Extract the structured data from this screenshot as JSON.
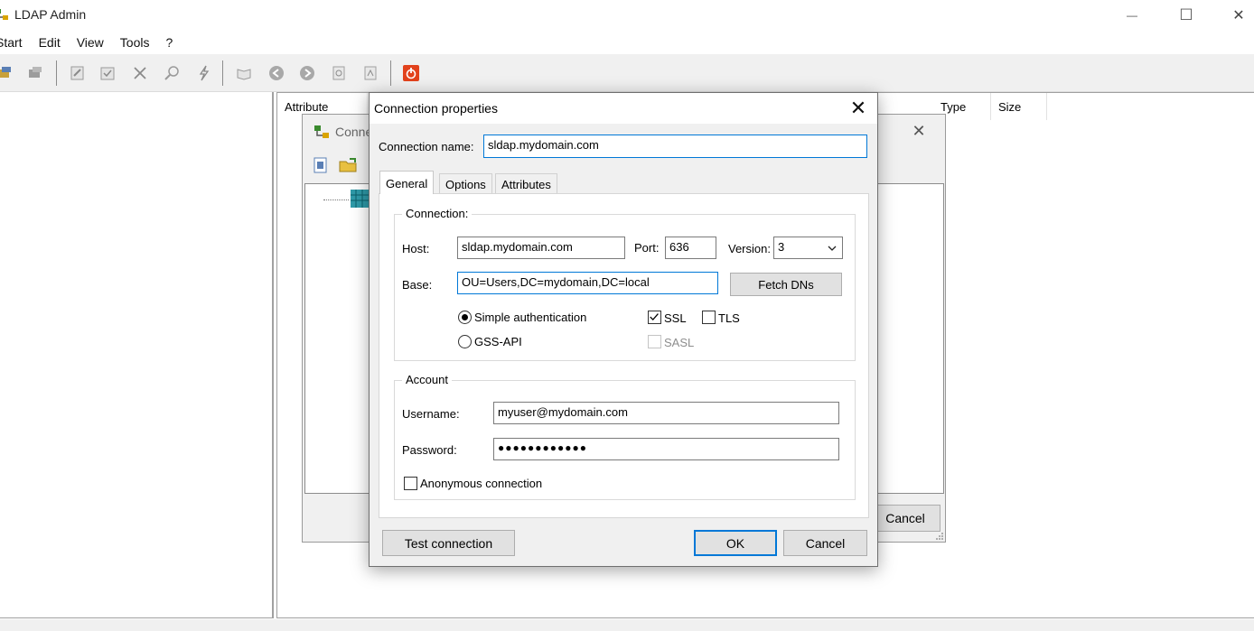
{
  "app": {
    "title": "LDAP Admin",
    "menu": [
      "Start",
      "Edit",
      "View",
      "Tools",
      "?"
    ],
    "window_controls": {
      "minimize": "—",
      "maximize": "☐",
      "close": "✕"
    }
  },
  "toolbar": {
    "icons": [
      "connect-icon",
      "disconnect-icon",
      "edit-icon",
      "save-icon",
      "delete-icon",
      "search-icon",
      "modify-icon",
      "bookmark-icon",
      "back-icon",
      "forward-icon",
      "refresh-icon",
      "schema-icon",
      "exit-icon"
    ],
    "accent": "#e2421c"
  },
  "entries_view": {
    "columns": [
      "Attribute",
      "Type",
      "Size"
    ]
  },
  "connections_dialog": {
    "title": "Conne",
    "close": "✕",
    "cancel_label": "Cancel"
  },
  "dialog": {
    "title": "Connection properties",
    "close": "✕",
    "connection_name_label": "Connection name:",
    "connection_name_value": "sldap.mydomain.com",
    "tabs": [
      "General",
      "Options",
      "Attributes"
    ],
    "active_tab": "General",
    "connection_group": {
      "title": "Connection:",
      "host_label": "Host:",
      "host_value": "sldap.mydomain.com",
      "port_label": "Port:",
      "port_value": "636",
      "version_label": "Version:",
      "version_value": "3",
      "base_label": "Base:",
      "base_value": "OU=Users,DC=mydomain,DC=local",
      "fetch_dns_label": "Fetch DNs",
      "simple_auth_label": "Simple authentication",
      "simple_auth_selected": true,
      "gss_api_label": "GSS-API",
      "gss_api_selected": false,
      "ssl_label": "SSL",
      "ssl_checked": true,
      "tls_label": "TLS",
      "tls_checked": false,
      "sasl_label": "SASL",
      "sasl_checked": false,
      "sasl_enabled": false
    },
    "account_group": {
      "title": "Account",
      "username_label": "Username:",
      "username_value": "myuser@mydomain.com",
      "password_label": "Password:",
      "password_value": "●●●●●●●●●●●●",
      "anonymous_label": "Anonymous connection",
      "anonymous_checked": false
    },
    "buttons": {
      "test_connection": "Test connection",
      "ok": "OK",
      "cancel": "Cancel"
    }
  }
}
